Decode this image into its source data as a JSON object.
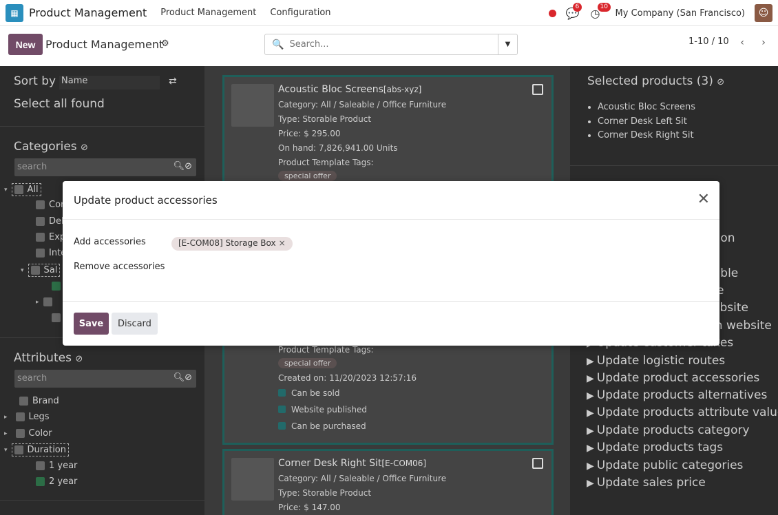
{
  "navbar": {
    "app_name": "Product Management",
    "menu": [
      "Product Management",
      "Configuration"
    ],
    "messages_count": "6",
    "activities_count": "10",
    "company": "My Company (San Francisco)"
  },
  "control_panel": {
    "new_label": "New",
    "title": "Product Management",
    "search_placeholder": "Search...",
    "pager": "1-10 / 10"
  },
  "left_panel": {
    "sort_by_label": "Sort by",
    "sort_value": "Name",
    "select_all": "Select all found",
    "categories_title": "Categories",
    "categories_search_placeholder": "search",
    "categories": [
      {
        "label": "All"
      },
      {
        "label": "Cor"
      },
      {
        "label": "Del"
      },
      {
        "label": "Exp"
      },
      {
        "label": "Inte"
      },
      {
        "label": "Sal"
      }
    ],
    "attributes_title": "Attributes",
    "attributes_search_placeholder": "search",
    "attributes": [
      {
        "label": "Brand"
      },
      {
        "label": "Legs"
      },
      {
        "label": "Color"
      },
      {
        "label": "Duration"
      },
      {
        "label": "1 year"
      },
      {
        "label": "2 year"
      }
    ]
  },
  "cards": [
    {
      "title": "Acoustic Bloc Screens",
      "ref": "[abs-xyz]",
      "category": "Category: All / Saleable / Office Furniture",
      "type": "Type: Storable Product",
      "price": "Price: $ 295.00",
      "on_hand": "On hand: 7,826,941.00 Units",
      "tags_label": "Product Template Tags:",
      "tag": "special offer"
    },
    {
      "tags_label": "Product Template Tags:",
      "tag": "special offer",
      "created": "Created on: 11/20/2023 12:57:16",
      "flags": [
        "Can be sold",
        "Website published",
        "Can be purchased"
      ]
    },
    {
      "title": "Corner Desk Right Sit",
      "ref": "[E-COM06]",
      "category": "Category: All / Saleable / Office Furniture",
      "type": "Type: Storable Product",
      "price": "Price: $ 147.00"
    }
  ],
  "right_panel": {
    "selected_title": "Selected products (3)",
    "selected": [
      "Acoustic Bloc Screens",
      "Corner Desk Left Sit",
      "Corner Desk Right Sit"
    ],
    "peek_fragments": [
      "tion",
      "sable",
      "e",
      "ebsite",
      "m website"
    ],
    "actions": [
      "Update customer taxes",
      "Update logistic routes",
      "Update product accessories",
      "Update products alternatives",
      "Update products attribute values",
      "Update products category",
      "Update products tags",
      "Update public categories",
      "Update sales price"
    ]
  },
  "modal": {
    "title": "Update product accessories",
    "add_label": "Add accessories",
    "add_chip": "[E-COM08] Storage Box",
    "remove_label": "Remove accessories",
    "save_label": "Save",
    "discard_label": "Discard"
  },
  "colors": {
    "primary": "#714b67",
    "badge": "#d9262c",
    "chip_bg": "#e9dfdf"
  }
}
